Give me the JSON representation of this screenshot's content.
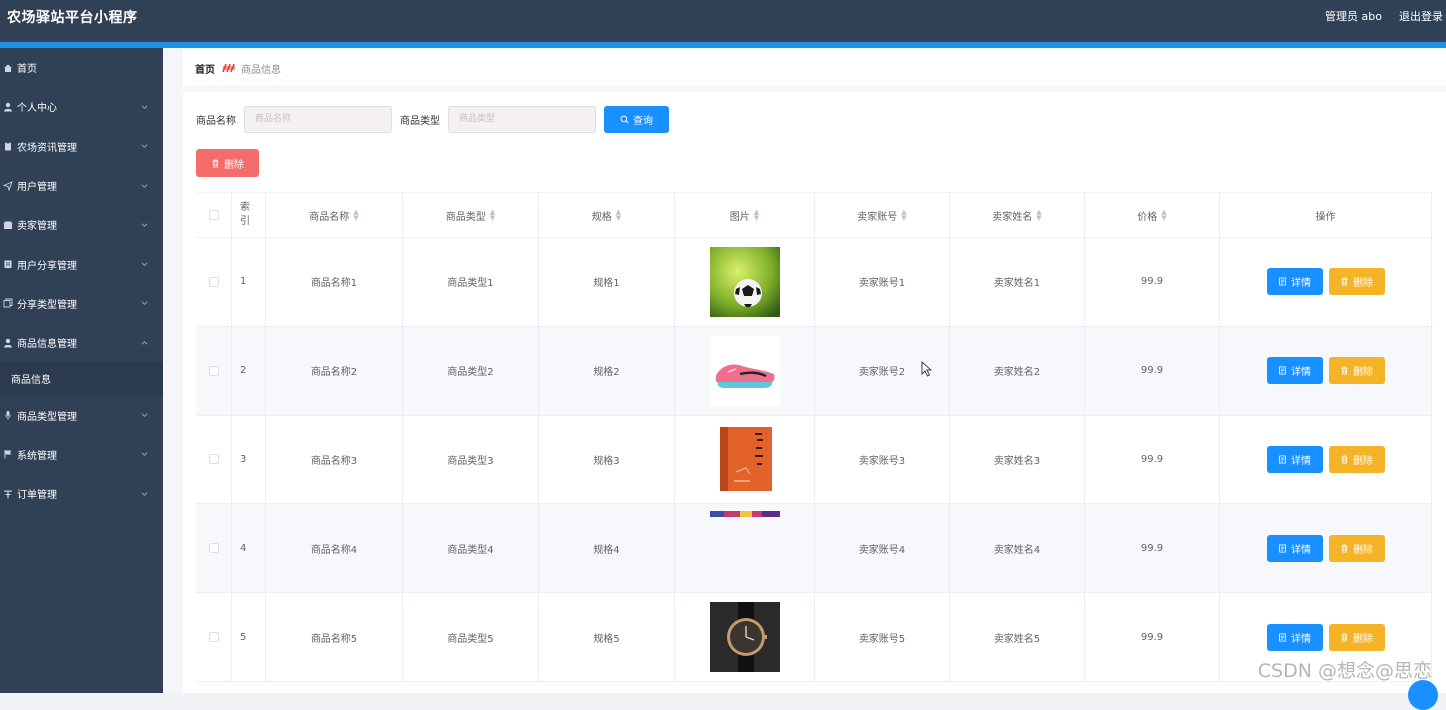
{
  "app": {
    "title": "农场驿站平台小程序",
    "user": "管理员 abo",
    "logout": "退出登录"
  },
  "sidebar": {
    "items": [
      {
        "label": "首页",
        "icon": "home-icon",
        "expandable": false
      },
      {
        "label": "个人中心",
        "icon": "user-icon",
        "expandable": true
      },
      {
        "label": "农场资讯管理",
        "icon": "clipboard-icon",
        "expandable": true
      },
      {
        "label": "用户管理",
        "icon": "send-icon",
        "expandable": true
      },
      {
        "label": "卖家管理",
        "icon": "shop-icon",
        "expandable": true
      },
      {
        "label": "用户分享管理",
        "icon": "doc-icon",
        "expandable": true
      },
      {
        "label": "分享类型管理",
        "icon": "copy-icon",
        "expandable": true
      },
      {
        "label": "商品信息管理",
        "icon": "user-icon",
        "expandable": true,
        "expanded": true,
        "children": [
          "商品信息"
        ]
      },
      {
        "label": "商品类型管理",
        "icon": "mic-icon",
        "expandable": true
      },
      {
        "label": "系统管理",
        "icon": "flag-icon",
        "expandable": true
      },
      {
        "label": "订单管理",
        "icon": "cart-icon",
        "expandable": true
      }
    ]
  },
  "breadcrumb": {
    "home": "首页",
    "current": "商品信息"
  },
  "search": {
    "name_label": "商品名称",
    "name_placeholder": "商品名称",
    "type_label": "商品类型",
    "type_placeholder": "商品类型",
    "query_label": "查询"
  },
  "toolbar": {
    "batch_delete_label": "删除"
  },
  "table": {
    "headers": [
      "索引",
      "商品名称",
      "商品类型",
      "规格",
      "图片",
      "卖家账号",
      "卖家姓名",
      "价格",
      "操作"
    ],
    "detail_label": "详情",
    "delete_label": "删除",
    "rows": [
      {
        "index": "1",
        "name": "商品名称1",
        "type": "商品类型1",
        "spec": "规格1",
        "image": "soccer-ball-image",
        "seller_account": "卖家账号1",
        "seller_name": "卖家姓名1",
        "price": "99.9"
      },
      {
        "index": "2",
        "name": "商品名称2",
        "type": "商品类型2",
        "spec": "规格2",
        "image": "pink-sneaker-image",
        "seller_account": "卖家账号2",
        "seller_name": "卖家姓名2",
        "price": "99.9"
      },
      {
        "index": "3",
        "name": "商品名称3",
        "type": "商品类型3",
        "spec": "规格3",
        "image": "orange-book-image",
        "seller_account": "卖家账号3",
        "seller_name": "卖家姓名3",
        "price": "99.9"
      },
      {
        "index": "4",
        "name": "商品名称4",
        "type": "商品类型4",
        "spec": "规格4",
        "image": "banner-strip-image",
        "seller_account": "卖家账号4",
        "seller_name": "卖家姓名4",
        "price": "99.9"
      },
      {
        "index": "5",
        "name": "商品名称5",
        "type": "商品类型5",
        "spec": "规格5",
        "image": "wrist-watch-image",
        "seller_account": "卖家账号5",
        "seller_name": "卖家姓名5",
        "price": "99.9"
      }
    ]
  },
  "watermark": "CSDN @想念@思恋",
  "colors": {
    "topbar": "#304156",
    "accent": "#1890ff",
    "danger": "#f56c6c",
    "warning": "#f5b428"
  }
}
